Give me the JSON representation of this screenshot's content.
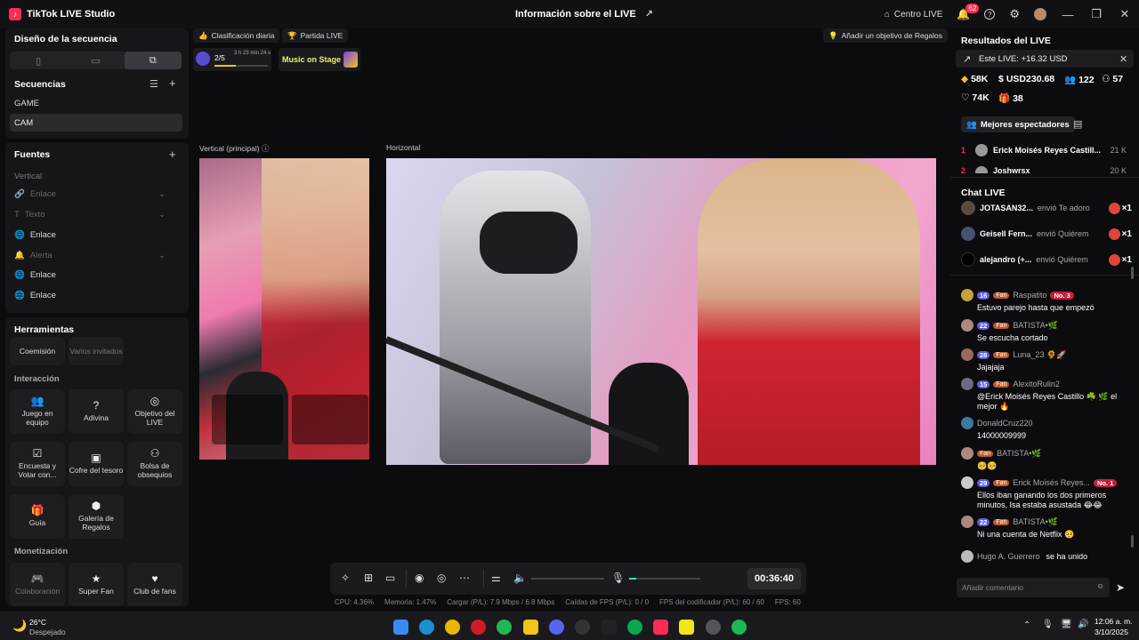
{
  "app": {
    "title": "TikTok LIVE Studio"
  },
  "header": {
    "title": "Información sobre el LIVE",
    "centro": "Centro LIVE",
    "notifications": "62"
  },
  "left": {
    "design_title": "Diseño de la secuencia",
    "sequences_title": "Secuencias",
    "sequences": [
      "GAME",
      "CAM"
    ],
    "sources_title": "Fuentes",
    "vertical_label": "Vertical",
    "sources": [
      {
        "label": "Enlace",
        "icon": "link-icon",
        "dim": true
      },
      {
        "label": "Texto",
        "icon": "text-icon",
        "dim": true
      },
      {
        "label": "Enlace",
        "icon": "globe-icon",
        "dim": false
      },
      {
        "label": "Alerta",
        "icon": "bell-icon",
        "dim": true
      },
      {
        "label": "Enlace",
        "icon": "globe-icon",
        "dim": false
      },
      {
        "label": "Enlace",
        "icon": "globe-icon",
        "dim": false
      }
    ],
    "tools_title": "Herramientas",
    "tools_top": [
      {
        "label": "Coemisión"
      },
      {
        "label": "Varios invitados"
      }
    ],
    "interaction_title": "Interacción",
    "interaction": [
      {
        "label": "Juego en equipo",
        "icon": "👥"
      },
      {
        "label": "Adivina",
        "icon": "?"
      },
      {
        "label": "Objetivo del LIVE",
        "icon": "◎"
      },
      {
        "label": "Encuesta y Votar con...",
        "icon": "☑"
      },
      {
        "label": "Cofre del tesoro",
        "icon": "▣"
      },
      {
        "label": "Bolsa de obsequios",
        "icon": "⚇"
      },
      {
        "label": "Guía",
        "icon": "🎁"
      },
      {
        "label": "Galería de Regalos",
        "icon": "⬢"
      }
    ],
    "monet_title": "Monetización",
    "monet": [
      {
        "label": "Colaboración",
        "icon": "🎮"
      },
      {
        "label": "Super Fan",
        "icon": "★"
      },
      {
        "label": "Club de fans",
        "icon": "♥"
      }
    ]
  },
  "center": {
    "chip_ranking": "Clasificación diaria",
    "chip_match": "Partida LIVE",
    "goal": "Añadir un objetivo de Regalos",
    "progress_count": "2/5",
    "progress_time": "3 h 23 min 24 s",
    "progress": 0.4,
    "music": "Music on Stage",
    "vertical_label": "Vertical (principal)",
    "horizontal_label": "Horizontal",
    "timer": "00:36:40"
  },
  "status": {
    "cpu": "CPU:  4.36%",
    "mem": "Memoria:  1.47%",
    "load": "Cargar (P/L):  7.9 Mbps / 6.8 Mbps",
    "drops": "Caídas de FPS (P/L):  0 / 0",
    "enc": "FPS del codificador (P/L):  60 / 60",
    "fps": "FPS:  60"
  },
  "right": {
    "title": "Resultados del LIVE",
    "banner": "Este LIVE: +16.32 USD",
    "stats": [
      "58K",
      "USD230.68",
      "122",
      "57",
      "74K",
      "38"
    ],
    "viewers_tab": "Mejores espectadores",
    "leaderboard": [
      {
        "rank": "1",
        "name": "Erick Moisés Reyes Castill...",
        "score": "21 K"
      },
      {
        "rank": "2",
        "name": "Joshwrsx",
        "score": "20 K"
      }
    ],
    "chat_title": "Chat LIVE",
    "gifts": [
      {
        "name": "JOTASAN32...",
        "text": "envió Te adoro",
        "count": "×1"
      },
      {
        "name": "Geisell Fern...",
        "text": "envió Quiérem",
        "count": "×1"
      },
      {
        "name": "alejandro (+...",
        "text": "envió Quiérem",
        "count": "×1"
      }
    ],
    "messages": [
      {
        "level": "16",
        "user": "Raspatito",
        "no": "No. 3",
        "text": "Estuvo parejo hasta que empezó"
      },
      {
        "level": "22",
        "user": "BATISTA•🌿",
        "no": "",
        "text": "Se escucha cortado"
      },
      {
        "level": "28",
        "user": "Luna_23 🌻🚀",
        "no": "",
        "text": "Jajajaja"
      },
      {
        "level": "15",
        "user": "AlexitoRulin2",
        "no": "",
        "text": "@Erick Moisés Reyes Castillo ☘️ 🌿 el mejor 🔥"
      },
      {
        "level": "",
        "user": "DonaldCruz220",
        "no": "",
        "text": "14000009999"
      },
      {
        "level": "",
        "user": "BATISTA•🌿",
        "no": "",
        "text": "🥺🥺"
      },
      {
        "level": "29",
        "user": "Erick Moisés Reyes...",
        "no": "No. 1",
        "text": "Ellos iban ganando los dos primeros minutos, Isa estaba asustada 😂😂"
      },
      {
        "level": "22",
        "user": "BATISTA•🌿",
        "no": "",
        "text": "Ni una cuenta de Netflix 🥺"
      }
    ],
    "join_user": "Hugo A. Guerrero",
    "join_text": "se ha unido",
    "comment_placeholder": "Añadir comentario"
  },
  "taskbar": {
    "temp": "26°C",
    "weather": "Despejado",
    "time": "12:06 a. m.",
    "date": "3/10/2025"
  }
}
